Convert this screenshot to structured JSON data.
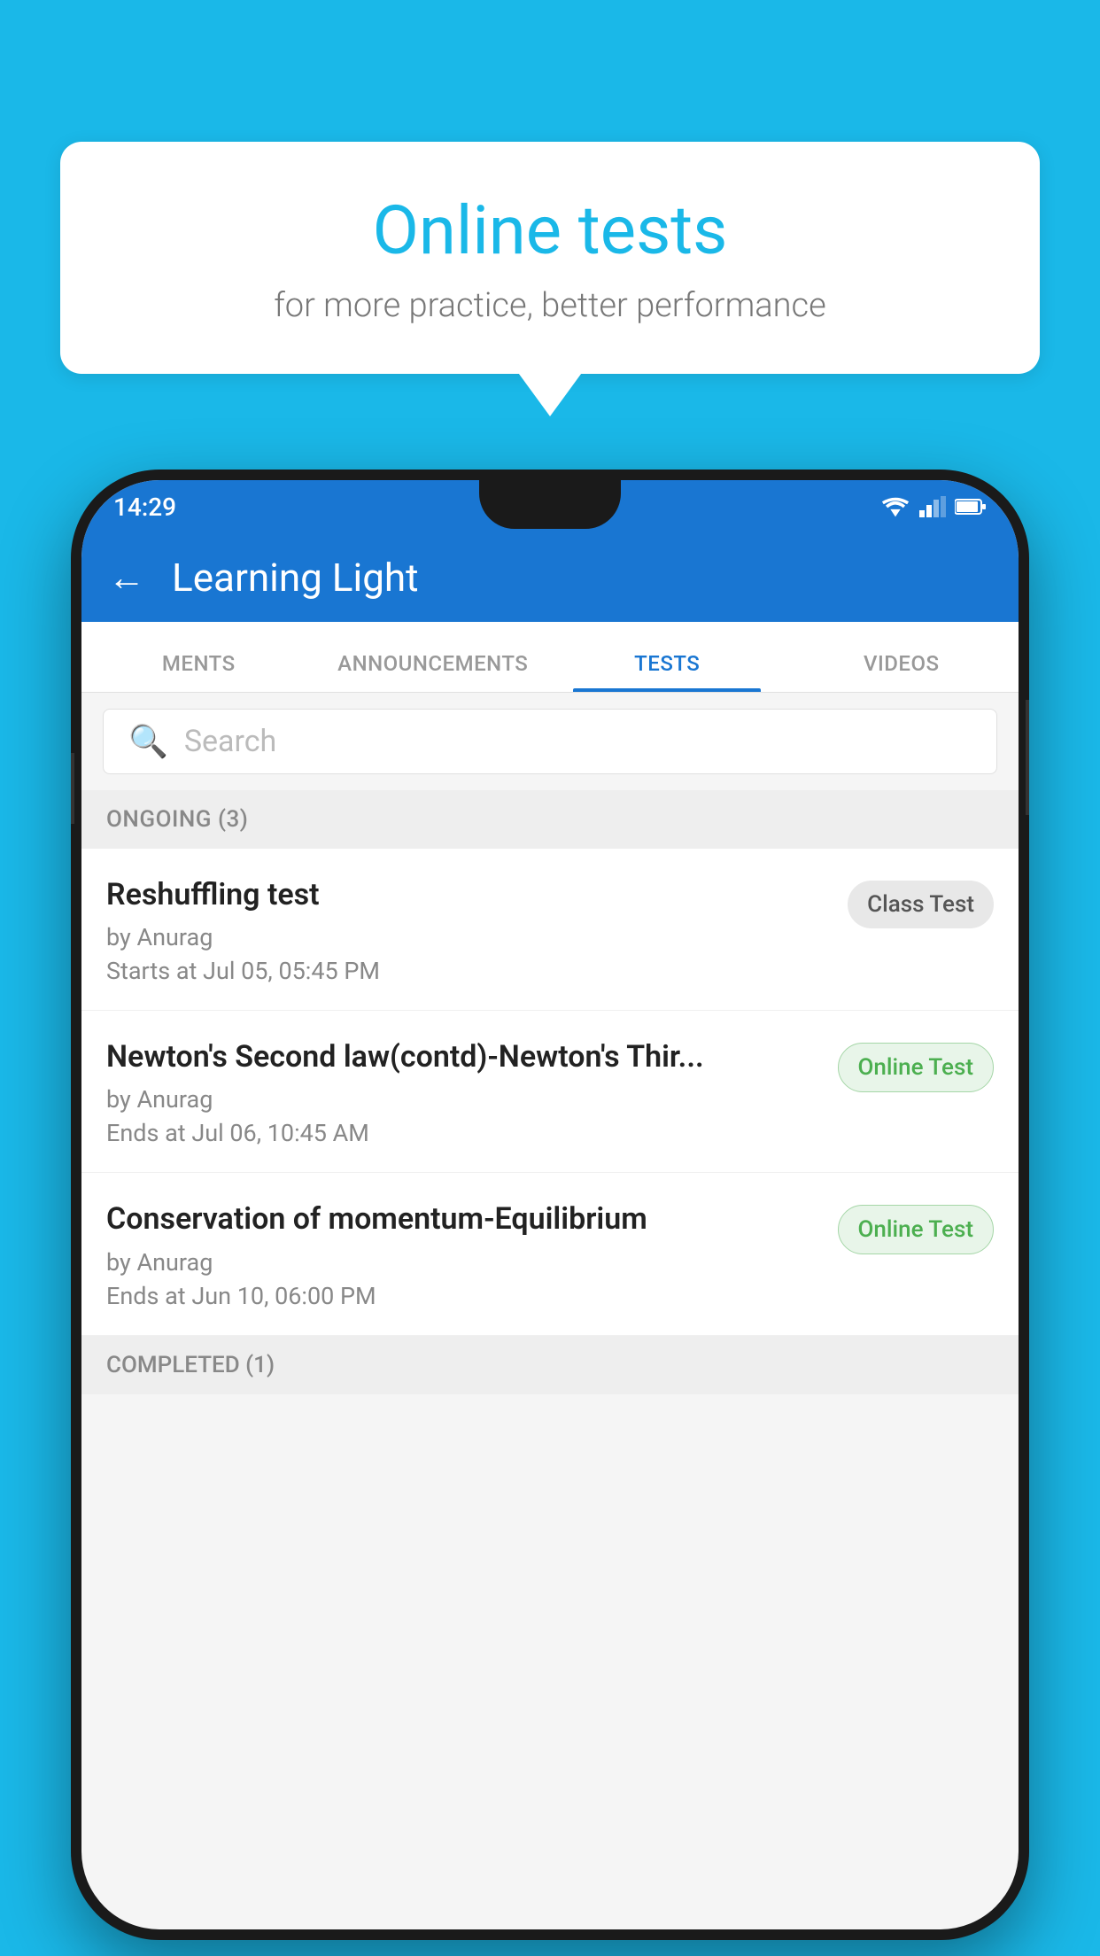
{
  "background_color": "#1ab8e8",
  "speech_bubble": {
    "title": "Online tests",
    "subtitle": "for more practice, better performance"
  },
  "status_bar": {
    "time": "14:29",
    "wifi": true,
    "signal": true,
    "battery": true
  },
  "app_bar": {
    "title": "Learning Light",
    "back_label": "←"
  },
  "tabs": [
    {
      "label": "MENTS",
      "active": false
    },
    {
      "label": "ANNOUNCEMENTS",
      "active": false
    },
    {
      "label": "TESTS",
      "active": true
    },
    {
      "label": "VIDEOS",
      "active": false
    }
  ],
  "search": {
    "placeholder": "Search"
  },
  "ongoing_section": {
    "label": "ONGOING (3)"
  },
  "tests": [
    {
      "title": "Reshuffling test",
      "author": "by Anurag",
      "date": "Starts at  Jul 05, 05:45 PM",
      "badge": "Class Test",
      "badge_type": "class"
    },
    {
      "title": "Newton's Second law(contd)-Newton's Thir...",
      "author": "by Anurag",
      "date": "Ends at  Jul 06, 10:45 AM",
      "badge": "Online Test",
      "badge_type": "online"
    },
    {
      "title": "Conservation of momentum-Equilibrium",
      "author": "by Anurag",
      "date": "Ends at  Jun 10, 06:00 PM",
      "badge": "Online Test",
      "badge_type": "online"
    }
  ],
  "completed_section": {
    "label": "COMPLETED (1)"
  }
}
